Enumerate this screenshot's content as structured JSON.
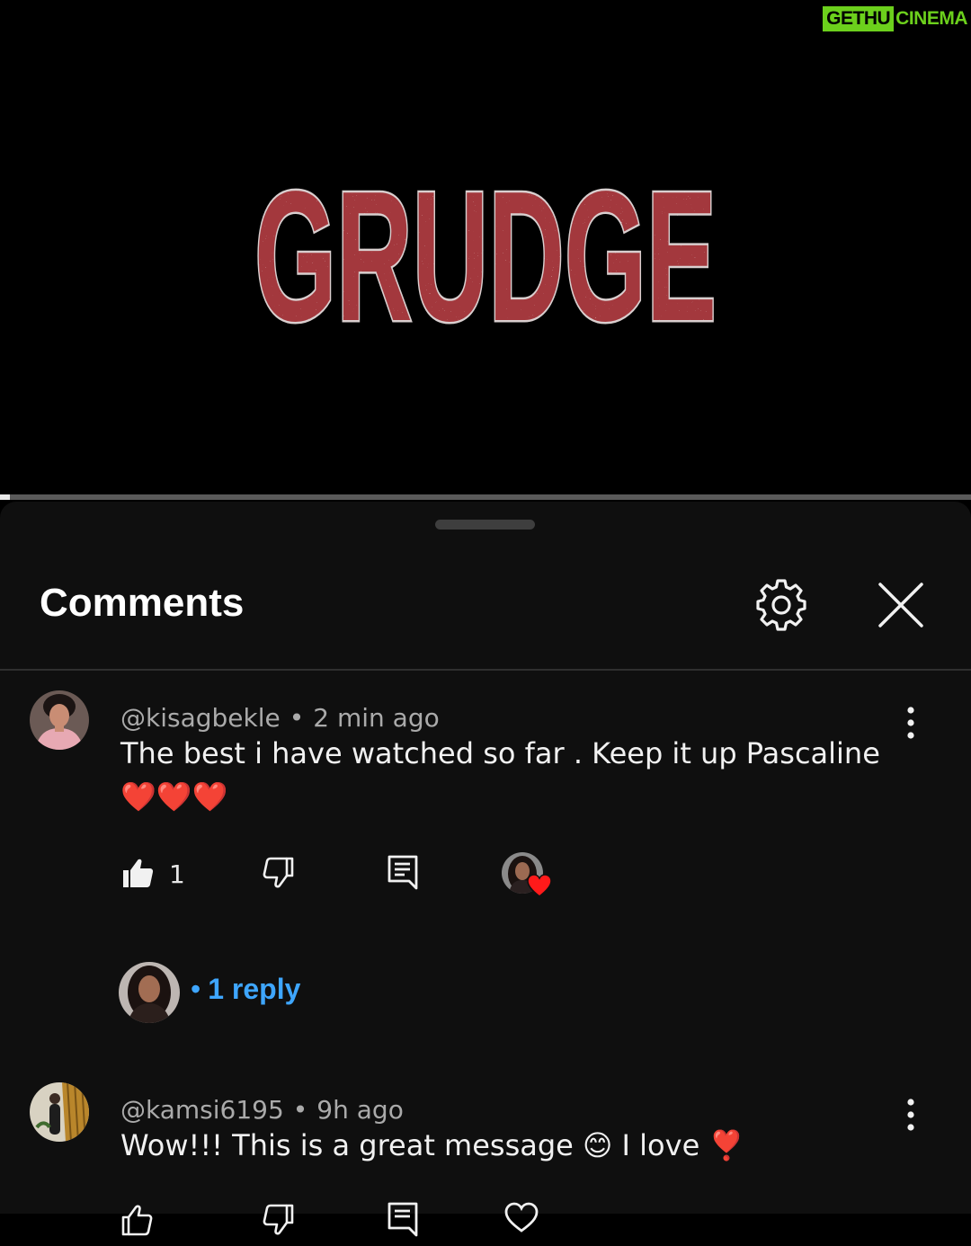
{
  "watermark": {
    "boxed": "GETHU",
    "rest": "CINEMA"
  },
  "video": {
    "title_art": "GRUDGE",
    "progress": 0.01
  },
  "header": {
    "title": "Comments"
  },
  "icons": {
    "settings": "gear-icon",
    "close": "close-icon",
    "more": "more-vert-icon",
    "like": "thumbs-up-icon",
    "dislike": "thumbs-down-icon",
    "reply": "reply-icon",
    "heart": "heart-icon"
  },
  "comments": [
    {
      "user": "@kisagbekle",
      "separator": "•",
      "time": "2 min ago",
      "text_line1": "The best i have watched so far . Keep it up Pascaline",
      "text_line2": "❤️❤️❤️",
      "likes": "1",
      "reply_link": {
        "bullet": "•",
        "label": "1 reply"
      }
    },
    {
      "user": "@kamsi6195",
      "separator": "•",
      "time": "9h ago",
      "text_line1": "Wow!!! This is a great message 😊 I love  ❣️"
    }
  ],
  "colors": {
    "sheet_bg": "#0f0f0f",
    "accent_link": "#3ea6ff",
    "title_red": "#a3393d",
    "watermark_green": "#6cd01c",
    "heart_red": "#ff1a1a"
  }
}
